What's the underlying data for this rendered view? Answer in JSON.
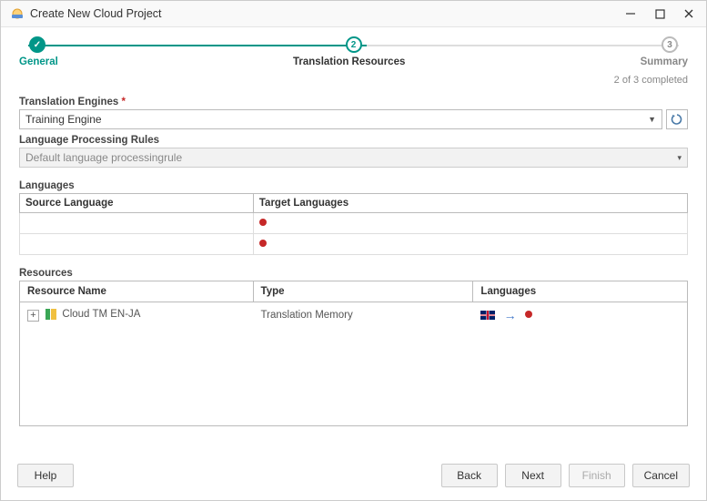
{
  "window": {
    "title": "Create New Cloud Project"
  },
  "stepper": {
    "steps": [
      {
        "label": "General",
        "state": "done",
        "badge": "✓"
      },
      {
        "label": "Translation Resources",
        "state": "active",
        "badge": "2"
      },
      {
        "label": "Summary",
        "state": "pending",
        "badge": "3"
      }
    ],
    "status": "2 of 3 completed"
  },
  "fields": {
    "translation_engines": {
      "label": "Translation Engines",
      "value": "Training Engine"
    },
    "lp_rules": {
      "label": "Language Processing Rules",
      "value": "Default language processingrule"
    }
  },
  "languages": {
    "section_label": "Languages",
    "cols": [
      "Source Language",
      "Target Languages"
    ],
    "rows": [
      {
        "source": "",
        "target_dot": true
      },
      {
        "source": "",
        "target_dot": true
      }
    ]
  },
  "resources": {
    "section_label": "Resources",
    "cols": [
      "Resource Name",
      "Type",
      "Languages"
    ],
    "rows": [
      {
        "name": "Cloud TM EN-JA",
        "type": "Translation Memory",
        "lang_src": "UK",
        "lang_tgt": "JA"
      }
    ]
  },
  "buttons": {
    "help": "Help",
    "back": "Back",
    "next": "Next",
    "finish": "Finish",
    "cancel": "Cancel"
  }
}
